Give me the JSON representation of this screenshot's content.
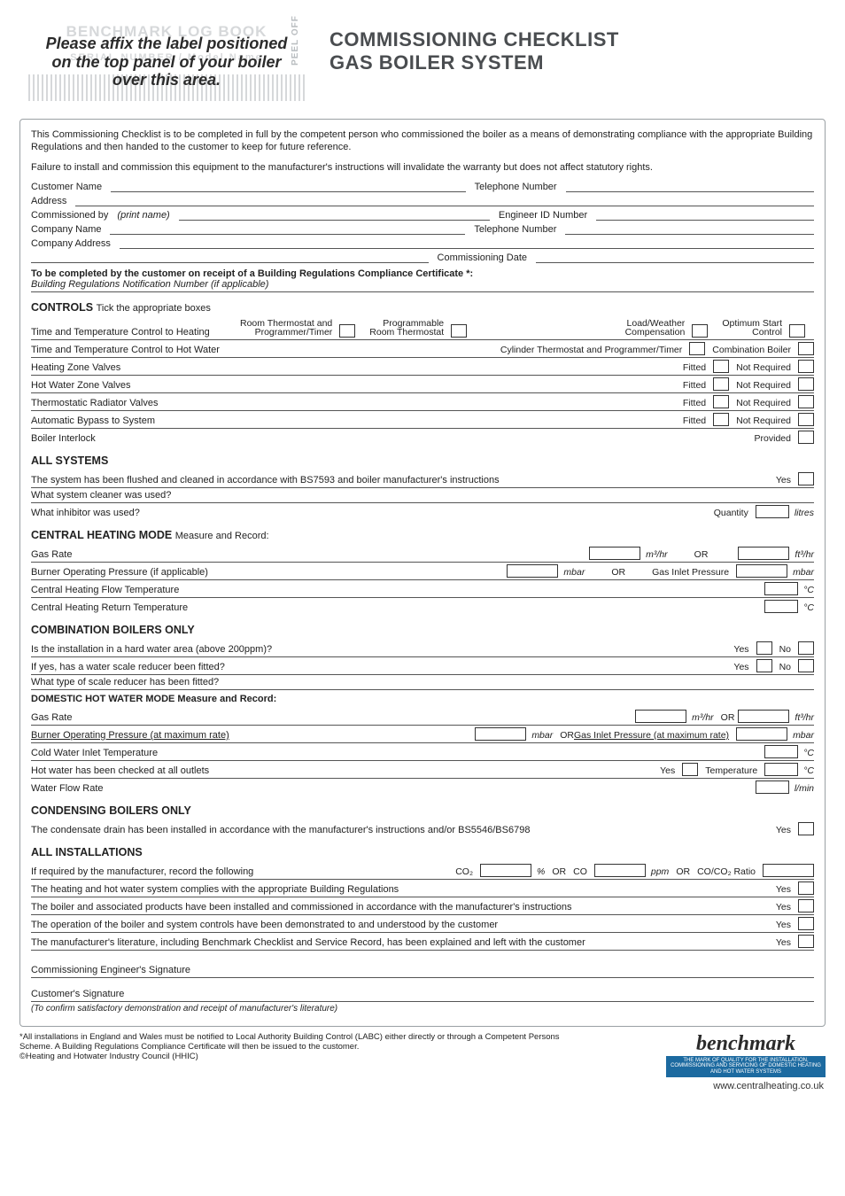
{
  "header": {
    "ghost_line1": "BENCHMARK LOG BOOK",
    "ghost_line2": "SERIAL NUMBER / Model Name",
    "affix1": "Please affix the label positioned",
    "affix2": "on the top panel of your boiler",
    "affix3": "over this area.",
    "peel": "PEEL OFF",
    "title1": "COMMISSIONING CHECKLIST",
    "title2": "GAS BOILER SYSTEM"
  },
  "intro": {
    "p1": "This Commissioning Checklist is to be completed in full by the competent person who commissioned the boiler as a means of demonstrating compliance with the appropriate Building Regulations and then handed to the customer to keep for future reference.",
    "p2": "Failure to install and commission this equipment to the manufacturer's instructions will invalidate the warranty but does not affect statutory rights."
  },
  "fields": {
    "customer_name": "Customer Name",
    "telephone1": "Telephone Number",
    "address": "Address",
    "commissioned_by": "Commissioned by",
    "print_name": "(print name)",
    "engineer_id": "Engineer ID Number",
    "company_name": "Company Name",
    "telephone2": "Telephone Number",
    "company_address": "Company Address",
    "commissioning_date": "Commissioning Date",
    "note": "To be completed by the customer on receipt of a Building Regulations Compliance Certificate *:",
    "note_sub": "Building Regulations Notification Number  (if applicable)"
  },
  "controls": {
    "title": "CONTROLS",
    "title_sub": "Tick the appropriate boxes",
    "heating_label": "Time and Temperature Control to Heating",
    "opts": {
      "o1a": "Room Thermostat and",
      "o1b": "Programmer/Timer",
      "o2a": "Programmable",
      "o2b": "Room Thermostat",
      "o3a": "Load/Weather",
      "o3b": "Compensation",
      "o4a": "Optimum Start",
      "o4b": "Control"
    },
    "hotwater_label": "Time and Temperature Control to Hot Water",
    "hw_opt1": "Cylinder Thermostat and Programmer/Timer",
    "hw_opt2": "Combination Boiler",
    "rows": [
      {
        "l": "Heating Zone Valves",
        "a": "Fitted",
        "b": "Not Required"
      },
      {
        "l": "Hot Water Zone Valves",
        "a": "Fitted",
        "b": "Not Required"
      },
      {
        "l": "Thermostatic Radiator Valves",
        "a": "Fitted",
        "b": "Not Required"
      },
      {
        "l": "Automatic Bypass to System",
        "a": "Fitted",
        "b": "Not Required"
      }
    ],
    "interlock_l": "Boiler Interlock",
    "interlock_r": "Provided"
  },
  "all_systems": {
    "title": "ALL SYSTEMS",
    "r1": "The system has been flushed and cleaned in accordance with BS7593 and boiler manufacturer's instructions",
    "yes": "Yes",
    "r2": "What system cleaner was used?",
    "r3": "What inhibitor was used?",
    "qty": "Quantity",
    "litres": "litres"
  },
  "central_heating": {
    "title": "CENTRAL HEATING MODE",
    "title_sub": "Measure and Record:",
    "gas_rate": "Gas Rate",
    "m3hr": "m³/hr",
    "or": "OR",
    "ft3hr": "ft³/hr",
    "burner": "Burner Operating Pressure (if applicable)",
    "mbar": "mbar",
    "inlet": "Gas Inlet Pressure",
    "flow": "Central Heating Flow Temperature",
    "c": "°C",
    "return": "Central Heating Return Temperature"
  },
  "combi": {
    "title": "COMBINATION BOILERS ONLY",
    "r1": "Is the installation in a hard water area (above 200ppm)?",
    "yes": "Yes",
    "no": "No",
    "r2": "If yes, has a water scale reducer been fitted?",
    "r3": "What type of scale reducer has been fitted?",
    "dhw_title": "DOMESTIC HOT WATER MODE Measure and Record:",
    "gas_rate": "Gas Rate",
    "m3hr": "m³/hr",
    "or": "OR",
    "ft3hr": "ft³/hr",
    "burner": "Burner Operating Pressure (at maximum rate)",
    "mbar": "mbar",
    "inlet": "Gas Inlet Pressure (at maximum rate)",
    "cold": "Cold Water Inlet Temperature",
    "c": "°C",
    "outlets": "Hot water has been checked at all outlets",
    "temp": "Temperature",
    "flow": "Water Flow Rate",
    "lmin": "l/min"
  },
  "condensing": {
    "title": "CONDENSING BOILERS ONLY",
    "r1": "The condensate drain has been installed in accordance with the manufacturer's instructions and/or BS5546/BS6798",
    "yes": "Yes"
  },
  "all_inst": {
    "title": "ALL INSTALLATIONS",
    "r1": "If required by the manufacturer, record the following",
    "co2": "CO₂",
    "pct": "%",
    "or": "OR",
    "co": "CO",
    "ppm": "ppm",
    "ratio": "CO/CO₂ Ratio",
    "r2": "The heating and hot water system complies with the appropriate Building Regulations",
    "r3": "The boiler and associated products have been installed and commissioned in accordance with the manufacturer's instructions",
    "r4": "The operation of the boiler and system controls have been demonstrated to and understood by the customer",
    "r5": "The manufacturer's literature, including Benchmark Checklist and Service Record, has been explained and left with the customer",
    "yes": "Yes"
  },
  "sign": {
    "eng": "Commissioning Engineer's Signature",
    "cust": "Customer's Signature",
    "note": "(To confirm satisfactory demonstration and receipt of manufacturer's literature)"
  },
  "footer": {
    "disclaimer": "*All installations in England and Wales must be notified to Local Authority Building Control (LABC) either directly or through a Competent Persons Scheme. A Building Regulations Compliance Certificate will then be issued to the customer.",
    "copyright": "©Heating and Hotwater Industry Council (HHIC)",
    "logo": "benchmark",
    "strip": "THE MARK OF QUALITY FOR THE INSTALLATION, COMMISSIONING AND SERVICING OF DOMESTIC HEATING AND HOT WATER SYSTEMS",
    "url": "www.centralheating.co.uk"
  }
}
